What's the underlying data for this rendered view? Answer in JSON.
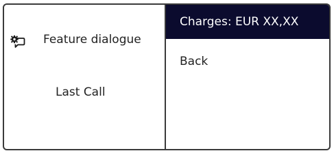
{
  "left_panel": {
    "feature_label": "Feature dialogue",
    "feature_icon": "feature-settings-chat-icon",
    "last_call_label": "Last Call"
  },
  "menu": {
    "items": [
      {
        "label": "Charges: EUR XX,XX",
        "selected": true
      },
      {
        "label": "Back",
        "selected": false
      }
    ]
  },
  "colors": {
    "selected_background": "#0b0b2e",
    "selected_text": "#ffffff",
    "border": "#3a3a3a",
    "text": "#222222"
  }
}
